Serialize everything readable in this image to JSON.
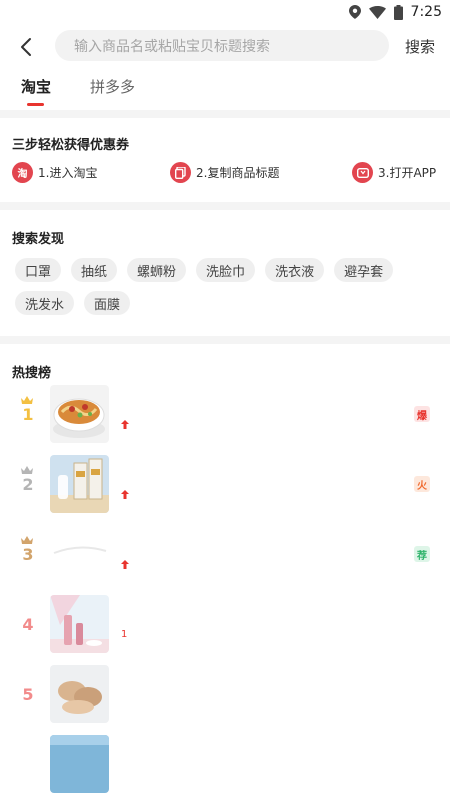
{
  "status_bar": {
    "time": "7:25"
  },
  "search": {
    "placeholder": "输入商品名或粘贴宝贝标题搜索",
    "button_label": "搜索"
  },
  "tabs": [
    {
      "label": "淘宝",
      "active": true
    },
    {
      "label": "拼多多",
      "active": false
    }
  ],
  "steps_section": {
    "title": "三步轻松获得优惠券",
    "steps": [
      {
        "icon": "taobao-icon",
        "icon_text": "淘",
        "label": "1.进入淘宝"
      },
      {
        "icon": "copy-icon",
        "label": "2.复制商品标题"
      },
      {
        "icon": "app-icon",
        "label": "3.打开APP"
      }
    ]
  },
  "discover_section": {
    "title": "搜索发现",
    "tags": [
      "口罩",
      "抽纸",
      "螺蛳粉",
      "洗脸巾",
      "洗衣液",
      "避孕套",
      "洗发水",
      "面膜"
    ]
  },
  "hot_section": {
    "title": "热搜榜",
    "items": [
      {
        "rank": "1",
        "crown": "gold",
        "trend": "up",
        "badge": "爆",
        "badge_color": "#e8342e"
      },
      {
        "rank": "2",
        "crown": "silver",
        "trend": "up",
        "badge": "火",
        "badge_color": "#f06a2e"
      },
      {
        "rank": "3",
        "crown": "bronze",
        "trend": "up",
        "badge": "荐",
        "badge_color": "#2fb36b"
      },
      {
        "rank": "4",
        "trend_text": "1"
      },
      {
        "rank": "5"
      }
    ]
  },
  "colors": {
    "accent": "#e8342e",
    "gold": "#f3c042",
    "silver": "#b5b5b5",
    "bronze": "#d2a46c",
    "rank_plain": "#f28b8b"
  }
}
